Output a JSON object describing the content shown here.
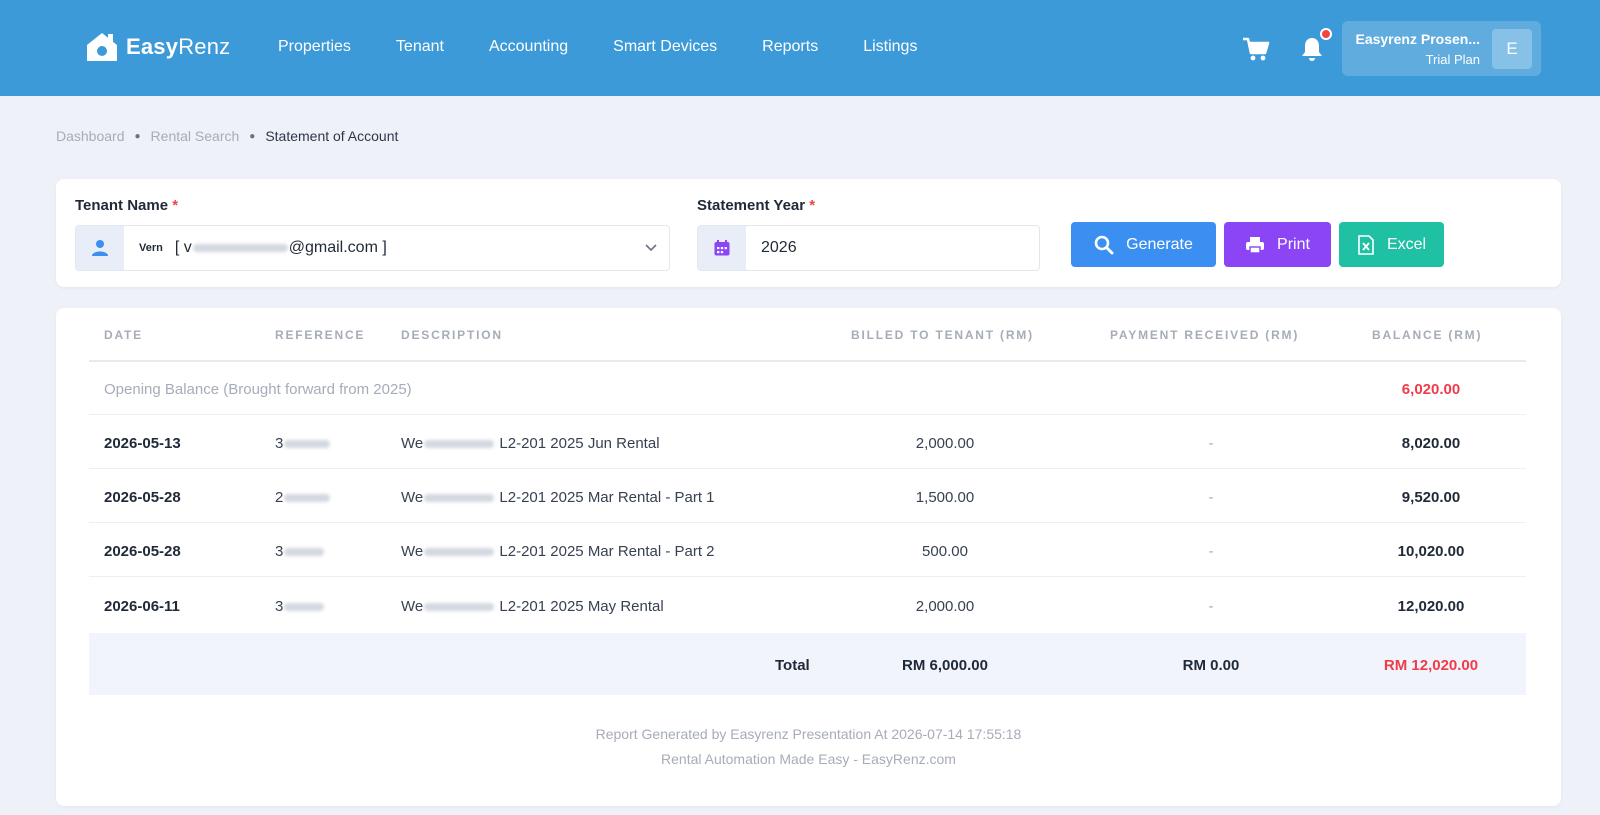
{
  "brand": {
    "name_bold": "Easy",
    "name_thin": "Renz"
  },
  "nav": [
    "Properties",
    "Tenant",
    "Accounting",
    "Smart Devices",
    "Reports",
    "Listings"
  ],
  "user": {
    "name": "Easyrenz Prosen...",
    "plan": "Trial Plan",
    "initial": "E"
  },
  "breadcrumb": [
    "Dashboard",
    "Rental Search",
    "Statement of Account"
  ],
  "filters": {
    "tenant_label": "Tenant Name",
    "tenant_prefix": "Vern",
    "tenant_email_start": "[ v",
    "tenant_email_end": "@gmail.com ]",
    "year_label": "Statement Year",
    "year_value": "2026",
    "required_mark": "*"
  },
  "buttons": {
    "generate": "Generate",
    "print": "Print",
    "excel": "Excel"
  },
  "table": {
    "headers": [
      "DATE",
      "REFERENCE",
      "DESCRIPTION",
      "BILLED TO TENANT (RM)",
      "PAYMENT RECEIVED (RM)",
      "BALANCE (RM)"
    ],
    "opening": {
      "label": "Opening Balance (Brought forward from 2025)",
      "balance": "6,020.00"
    },
    "rows": [
      {
        "date": "2026-05-13",
        "ref": "3",
        "desc_start": "We",
        "desc_end": "L2-201 2025 Jun Rental",
        "billed": "2,000.00",
        "paid": "-",
        "balance": "8,020.00"
      },
      {
        "date": "2026-05-28",
        "ref": "2",
        "desc_start": "We",
        "desc_end": "L2-201 2025 Mar Rental - Part 1",
        "billed": "1,500.00",
        "paid": "-",
        "balance": "9,520.00"
      },
      {
        "date": "2026-05-28",
        "ref": "3",
        "desc_start": "We",
        "desc_end": "L2-201 2025 Mar Rental - Part 2",
        "billed": "500.00",
        "paid": "-",
        "balance": "10,020.00"
      },
      {
        "date": "2026-06-11",
        "ref": "3",
        "desc_start": "We",
        "desc_end": "L2-201 2025 May Rental",
        "billed": "2,000.00",
        "paid": "-",
        "balance": "12,020.00"
      }
    ],
    "total": {
      "label": "Total",
      "billed": "RM 6,000.00",
      "paid": "RM 0.00",
      "balance": "RM 12,020.00"
    }
  },
  "footer": {
    "line1": "Report Generated by Easyrenz Presentation At 2026-07-14 17:55:18",
    "line2": "Rental Automation Made Easy - EasyRenz.com"
  },
  "colors": {
    "topbar": "#3d9ad8",
    "generate": "#3b8ff0",
    "print": "#8b45f5",
    "excel": "#1fc0a4",
    "negative": "#ef3b4b"
  }
}
